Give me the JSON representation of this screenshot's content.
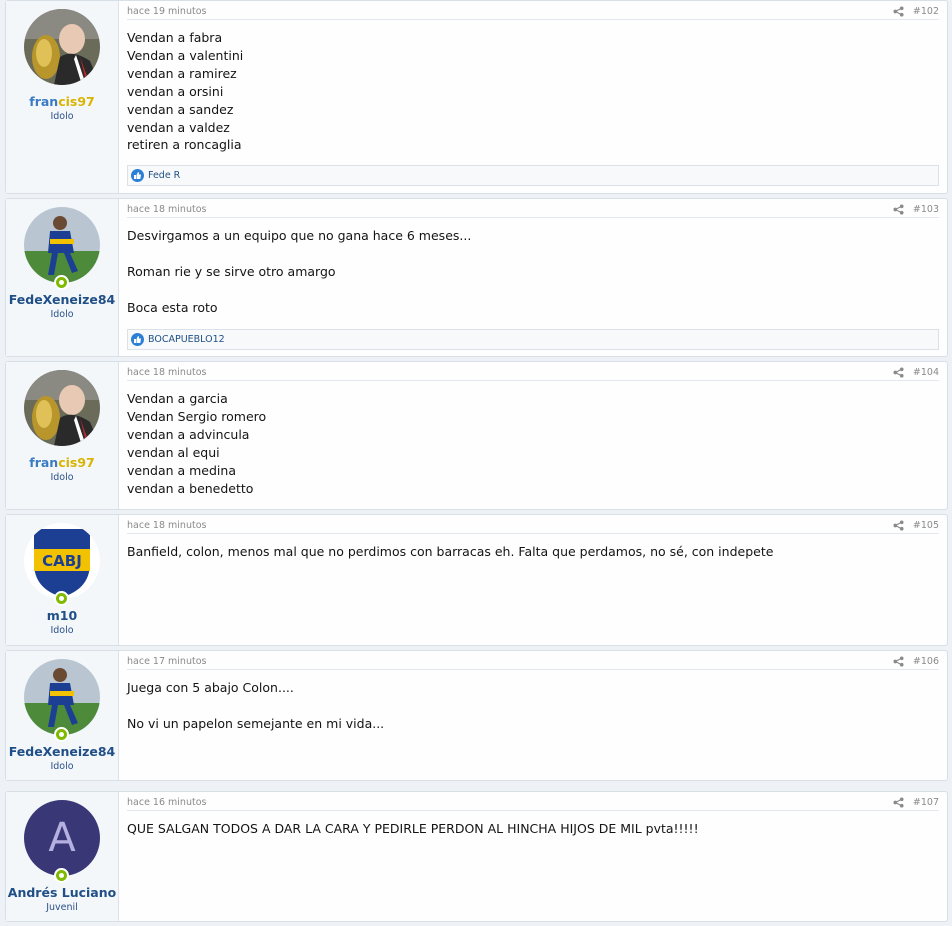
{
  "posts": [
    {
      "username_part1": "fran",
      "username_part2": "cis97",
      "user_title": "Idolo",
      "time": "hace 19 minutos",
      "number": "#102",
      "lines": [
        "Vendan a fabra",
        "Vendan a valentini",
        "vendan a ramirez",
        "vendan a orsini",
        "vendan a sandez",
        "vendan a valdez",
        "retiren a roncaglia"
      ],
      "reaction_user": "Fede R"
    },
    {
      "username": "FedeXeneize84",
      "user_title": "Idolo",
      "time": "hace 18 minutos",
      "number": "#103",
      "lines": [
        "Desvirgamos a un equipo que no gana hace 6 meses...",
        "",
        "Roman rie y se sirve otro amargo",
        "",
        "Boca esta roto"
      ],
      "reaction_user": "BOCAPUEBLO12"
    },
    {
      "username_part1": "fran",
      "username_part2": "cis97",
      "user_title": "Idolo",
      "time": "hace 18 minutos",
      "number": "#104",
      "lines": [
        "Vendan a garcia",
        "Vendan Sergio romero",
        "vendan a advincula",
        "vendan al equi",
        "vendan a medina",
        "vendan a benedetto"
      ]
    },
    {
      "username": "m10",
      "user_title": "Idolo",
      "avatar_text": "CABJ",
      "time": "hace 18 minutos",
      "number": "#105",
      "lines": [
        "Banfield, colon, menos mal que no perdimos con barracas eh. Falta que perdamos, no sé, con indepete"
      ]
    },
    {
      "username": "FedeXeneize84",
      "user_title": "Idolo",
      "time": "hace 17 minutos",
      "number": "#106",
      "lines": [
        "Juega con 5 abajo Colon....",
        "",
        "No vi un papelon semejante en mi vida..."
      ]
    },
    {
      "username": "Andrés Luciano",
      "user_title": "Juvenil",
      "avatar_letter": "A",
      "time": "hace 16 minutos",
      "number": "#107",
      "lines": [
        "QUE SALGAN TODOS A DAR LA CARA Y PEDIRLE PERDON AL HINCHA HIJOS DE MIL pvta!!!!!"
      ]
    }
  ],
  "colors": {
    "username_blue": "#1f4f86",
    "francis_blue": "#3a7cc4",
    "francis_gold": "#d9b400",
    "online_green": "#7fb900",
    "like_blue": "#2b80d6",
    "letter_avatar_bg": "#3a3777",
    "boca_blue": "#1c3f94",
    "boca_gold": "#f2c200"
  },
  "icons": {
    "share": "share-icon",
    "like": "like-icon",
    "online": "online-status-icon"
  }
}
